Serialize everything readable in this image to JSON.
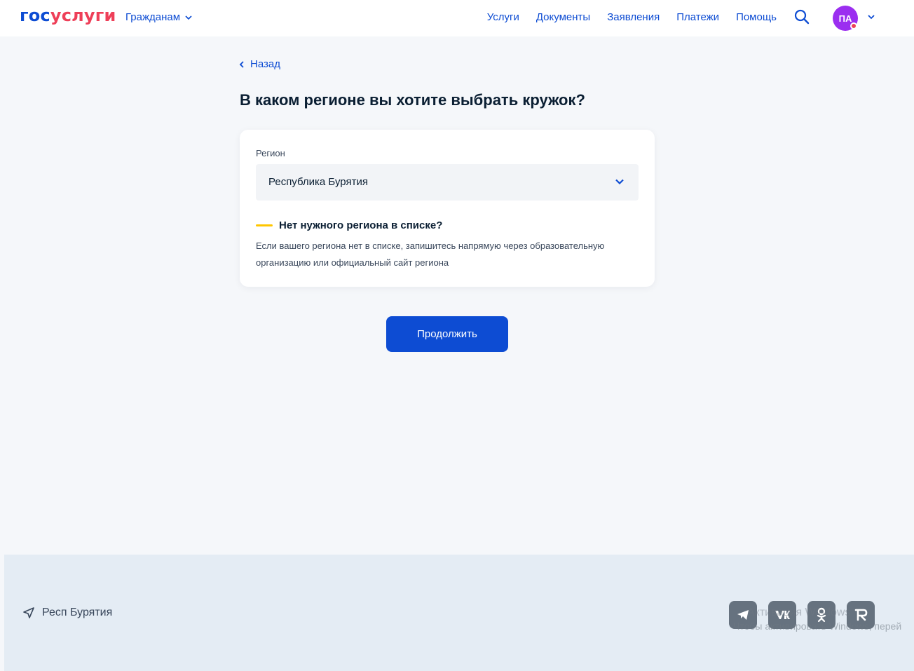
{
  "header": {
    "logo_part1": "гос",
    "logo_part2": "услуги",
    "persona_label": "Гражданам",
    "nav": [
      "Услуги",
      "Документы",
      "Заявления",
      "Платежи",
      "Помощь"
    ],
    "avatar_initials": "ПА"
  },
  "main": {
    "back_label": "Назад",
    "title": "В каком регионе вы хотите выбрать кружок?",
    "region_label": "Регион",
    "region_value": "Республика Бурятия",
    "hint_title": "Нет нужного региона в списке?",
    "hint_text": "Если вашего региона нет в списке, запишитесь напрямую через образовательную организацию или официальный сайт региона",
    "continue_label": "Продолжить"
  },
  "footer": {
    "location": "Респ Бурятия",
    "social": [
      "telegram",
      "vk",
      "odnoklassniki",
      "rutube"
    ],
    "watermark_title": "Активация Windows",
    "watermark_text": "Чтобы активировать Windows, перей"
  },
  "colors": {
    "brand_blue": "#0d4cd3",
    "brand_red": "#ee3f58",
    "avatar": "#9b2ef0",
    "hint_accent": "#ffc600"
  }
}
